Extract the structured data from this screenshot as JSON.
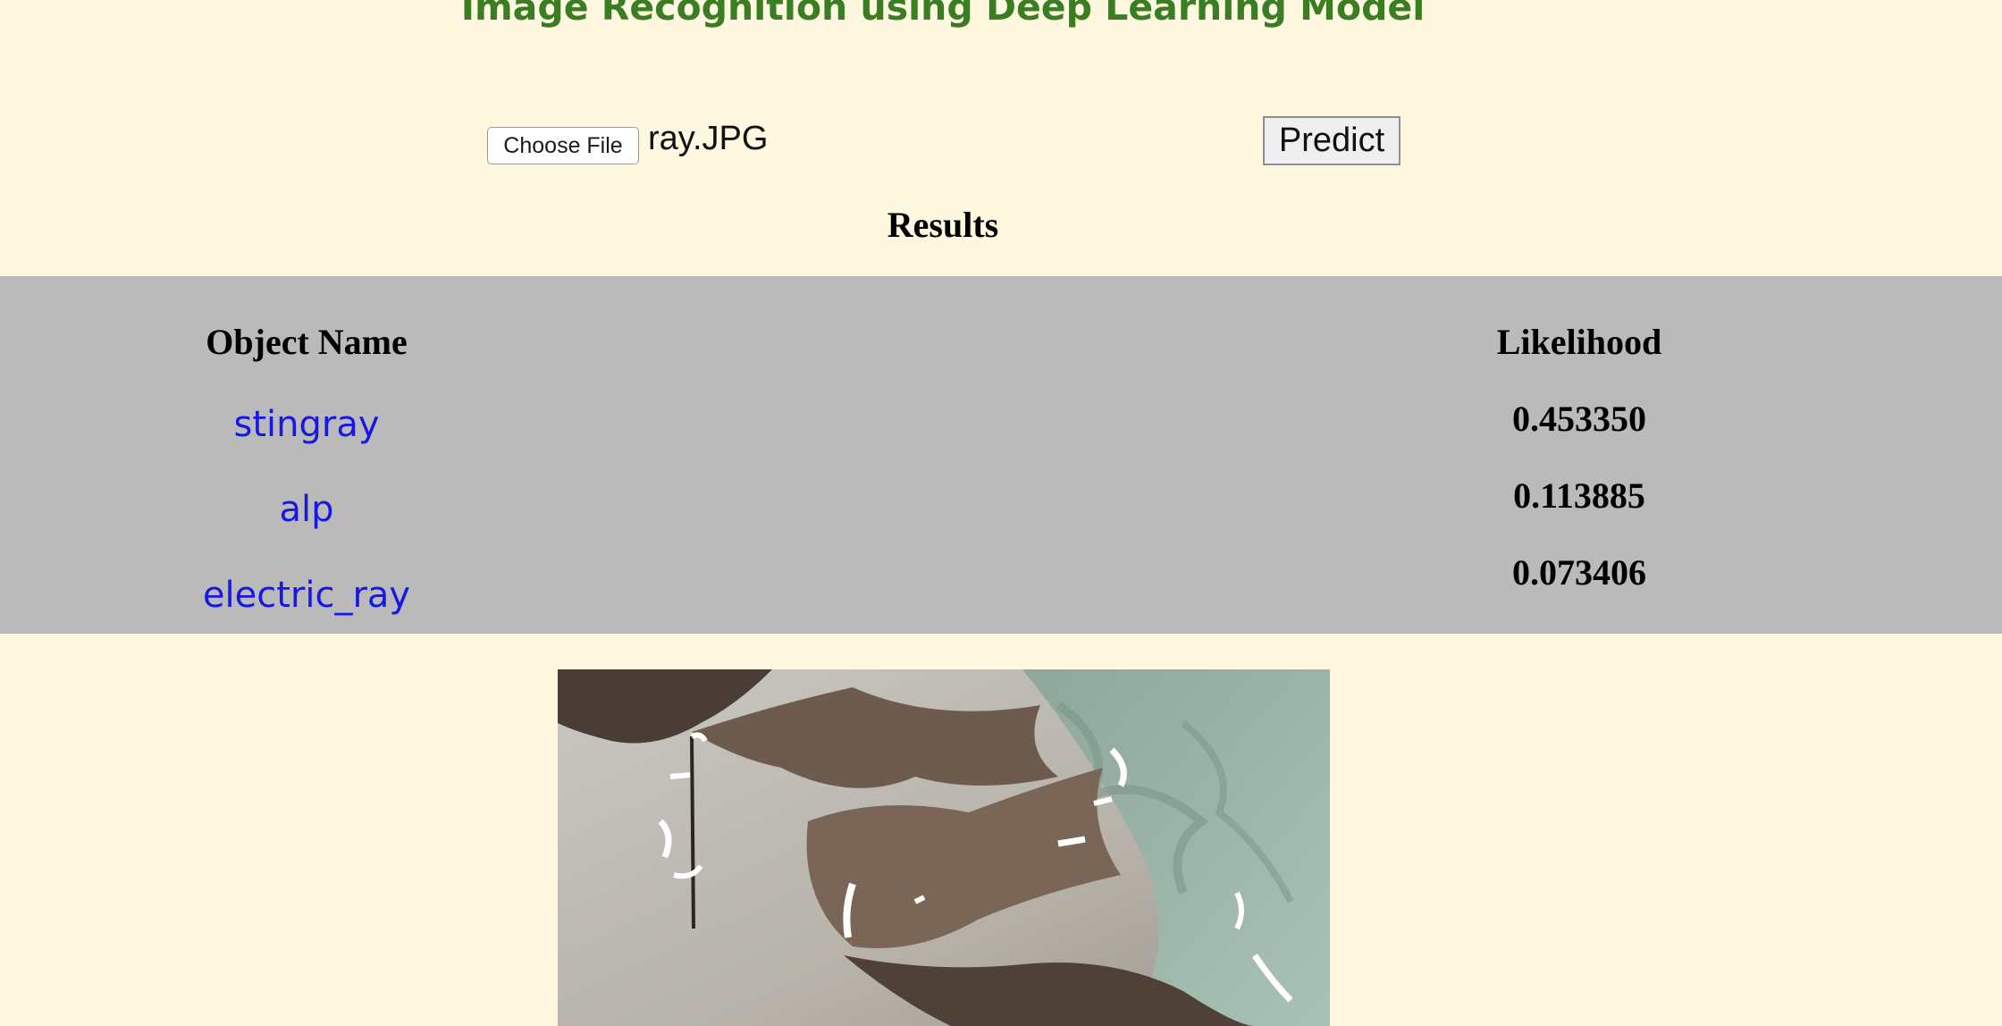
{
  "header": {
    "title": "Image Recognition using Deep Learning Model"
  },
  "upload": {
    "choose_file_label": "Choose File",
    "file_name": "ray.JPG",
    "predict_label": "Predict"
  },
  "results": {
    "heading": "Results",
    "columns": [
      "Object Name",
      "Likelihood"
    ],
    "rows": [
      {
        "name": "stingray",
        "likelihood": "0.453350"
      },
      {
        "name": "alp",
        "likelihood": "0.113885"
      },
      {
        "name": "electric_ray",
        "likelihood": "0.073406"
      }
    ]
  },
  "colors": {
    "page_background": "#fef8e0",
    "title": "#3b7d22",
    "panel_background": "#bababa",
    "object_name": "#1717e6"
  }
}
